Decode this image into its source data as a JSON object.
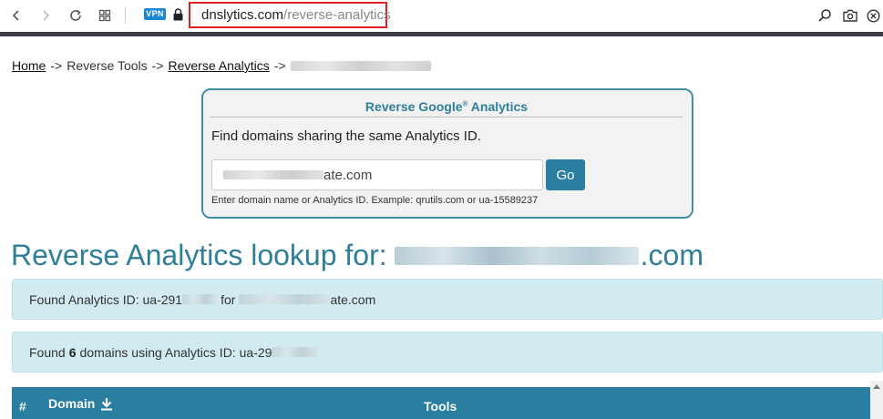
{
  "browser": {
    "vpn_label": "VPN",
    "url_host": "dnslytics.com",
    "url_path": "/reverse-analytics"
  },
  "breadcrumb": {
    "home": "Home",
    "sep1": "->",
    "tools": "Reverse Tools",
    "sep2": "->",
    "reverse_analytics": "Reverse Analytics",
    "sep3": "->"
  },
  "search_panel": {
    "title": "Reverse Google",
    "title_mark": "®",
    "title_suffix": " Analytics",
    "description": "Find domains sharing the same Analytics ID.",
    "input_value_visible": "ate.com",
    "go_label": "Go",
    "hint": "Enter domain name or Analytics ID. Example: qrutils.com or ua-15589237"
  },
  "heading": {
    "prefix": "Reverse Analytics lookup for:",
    "suffix": ".com"
  },
  "info1": {
    "prefix": "Found Analytics ID: ua-291",
    "middle": "for",
    "suffix": "ate.com"
  },
  "info2": {
    "prefix": "Found",
    "count": "6",
    "suffix": "domains using Analytics ID: ua-29"
  },
  "table": {
    "col_hash": "#",
    "col_domain": "Domain",
    "col_tools": "Tools"
  },
  "colors": {
    "accent": "#2a7fa0",
    "info_bg": "#d1ebf1",
    "url_highlight": "#e02121"
  }
}
